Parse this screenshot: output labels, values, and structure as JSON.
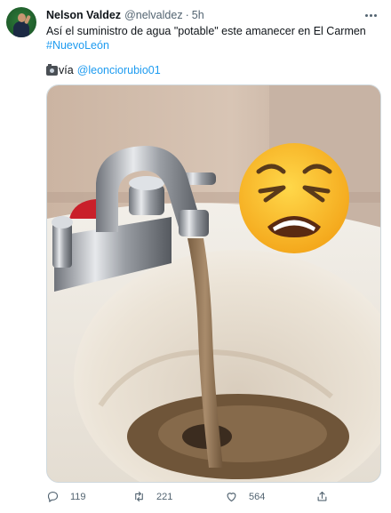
{
  "tweet": {
    "author_name": "Nelson Valdez",
    "handle": "@nelvaldez",
    "separator": "·",
    "time": "5h",
    "text": "Así el suministro de agua \"potable\" este amanecer en El Carmen",
    "hashtag": "#NuevoLeón",
    "via_label": "vía",
    "via_mention": "@leonciorubio01"
  },
  "actions": {
    "reply_count": "119",
    "retweet_count": "221",
    "like_count": "564"
  },
  "icons": {
    "avatar": "profile-photo",
    "more": "ellipsis-icon",
    "via": "camera-icon",
    "reply": "comment-icon",
    "retweet": "retweet-icon",
    "like": "heart-icon",
    "share": "share-icon"
  },
  "colors": {
    "link": "#1d9bf0",
    "secondary_text": "#536471",
    "water": "#8a6f50"
  }
}
